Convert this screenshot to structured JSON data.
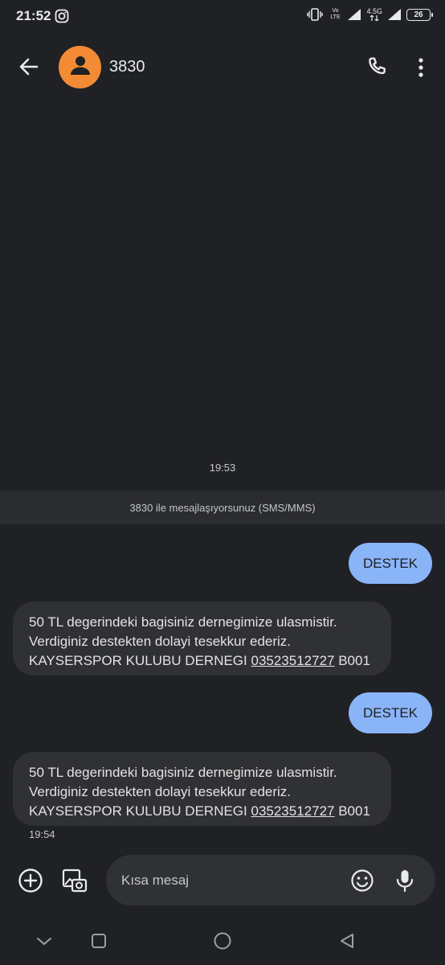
{
  "status_bar": {
    "time": "21:52",
    "left_icons": [
      "instagram-icon"
    ],
    "right_icons": [
      "vibrate-icon",
      "volte-icon",
      "signal-icon",
      "network-4g-icon",
      "signal-icon",
      "battery-icon"
    ],
    "volte_label": "Vo LTE",
    "network_label": "4.5G",
    "battery_level": "26"
  },
  "header": {
    "contact_name": "3830",
    "icons": {
      "back": "arrow-back-icon",
      "avatar": "person-icon",
      "call": "phone-icon",
      "more": "more-vert-icon"
    }
  },
  "conversation": {
    "top_timestamp": "19:53",
    "info_banner": "3830 ile mesajlaşıyorsunuz (SMS/MMS)",
    "messages": [
      {
        "direction": "outgoing",
        "text": "DESTEK"
      },
      {
        "direction": "incoming",
        "line1": "50 TL degerindeki bagisiniz dernegimize ulasmistir.",
        "line2": "Verdiginiz destekten dolayi tesekkur ederiz.",
        "line3_prefix": "KAYSERSPOR KULUBU DERNEGI ",
        "phone": "03523512727",
        "line3_suffix": " B001"
      },
      {
        "direction": "outgoing",
        "text": "DESTEK"
      },
      {
        "direction": "incoming",
        "line1": "50 TL degerindeki bagisiniz dernegimize ulasmistir.",
        "line2": "Verdiginiz destekten dolayi tesekkur ederiz.",
        "line3_prefix": "KAYSERSPOR KULUBU DERNEGI ",
        "phone": "03523512727",
        "line3_suffix": " B001"
      }
    ],
    "last_timestamp": "19:54"
  },
  "compose": {
    "placeholder": "Kısa mesaj",
    "icons": {
      "add": "add-circle-icon",
      "gallery": "gallery-camera-icon",
      "emoji": "emoji-icon",
      "mic": "mic-icon"
    }
  },
  "nav_bar": {
    "icons": [
      "chevron-down-icon",
      "recents-square-icon",
      "home-circle-icon",
      "back-triangle-icon"
    ]
  },
  "colors": {
    "background": "#202124",
    "outgoing_bubble": "#8ab4f8",
    "incoming_bubble": "#303134",
    "avatar": "#f28b34"
  }
}
